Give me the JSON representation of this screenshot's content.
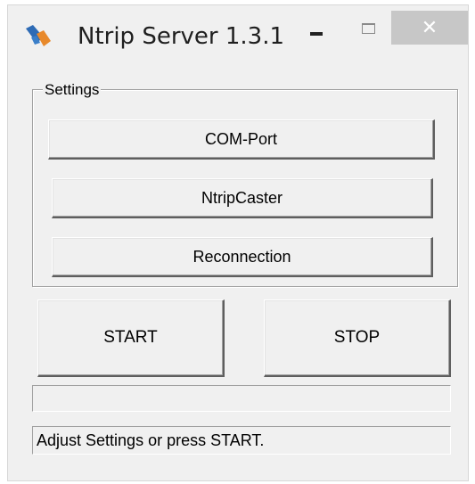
{
  "window": {
    "title": "Ntrip Server 1.3.1",
    "close_symbol": "✕",
    "icons": [
      "app-icon",
      "minimize-icon",
      "maximize-icon",
      "close-icon"
    ]
  },
  "settings": {
    "group_label": "Settings",
    "com_port_label": "COM-Port",
    "ntrip_caster_label": "NtripCaster",
    "reconnection_label": "Reconnection"
  },
  "controls": {
    "start_label": "START",
    "stop_label": "STOP"
  },
  "progress": {
    "value": 0
  },
  "status": {
    "text": "Adjust Settings or press START."
  },
  "colors": {
    "window_bg": "#f0f0f0",
    "close_button_bg": "#c7c7c7",
    "icon_blue": "#2e6bb5",
    "icon_orange": "#e8892b"
  }
}
